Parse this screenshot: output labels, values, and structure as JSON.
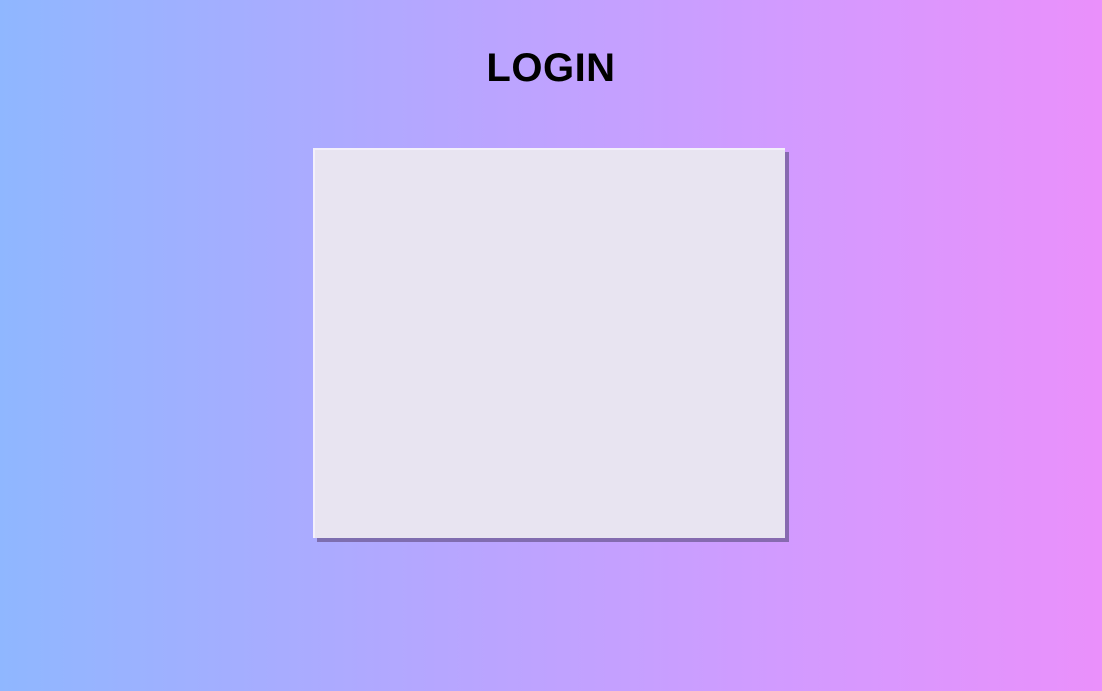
{
  "page": {
    "title": "LOGIN"
  },
  "theme": {
    "gradient_start": "#8fb7ff",
    "gradient_end": "#ea90fb",
    "panel_background": "#e8e4f1",
    "title_color": "#000000"
  }
}
